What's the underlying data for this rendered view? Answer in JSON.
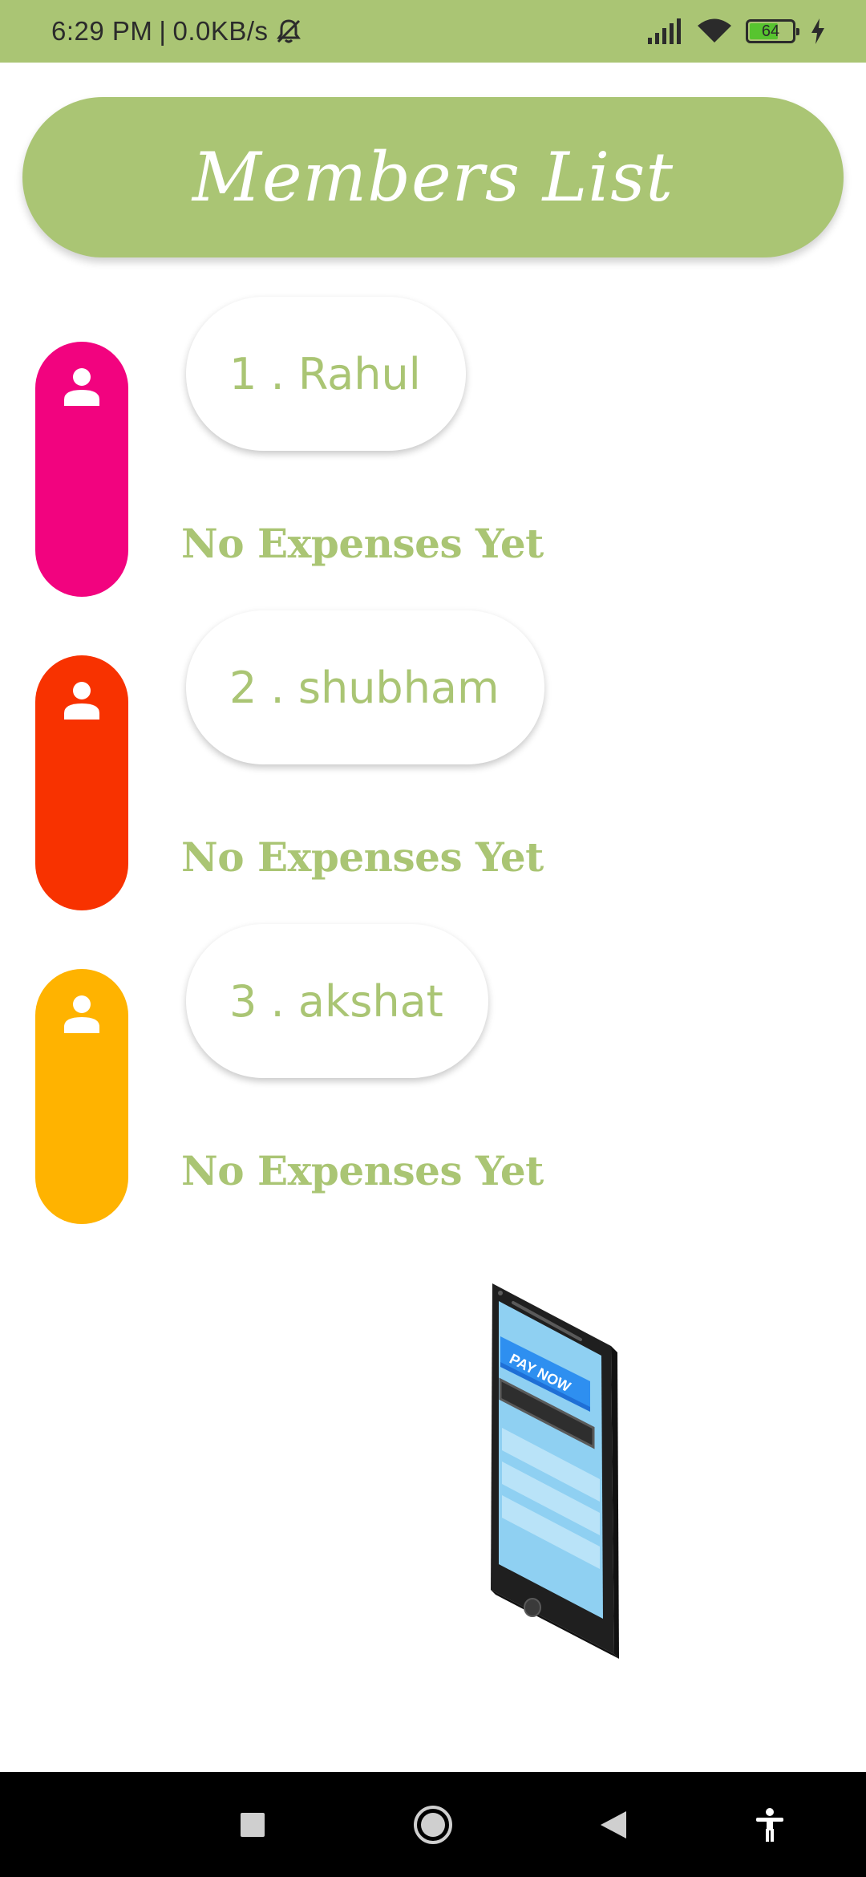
{
  "status_bar": {
    "time": "6:29 PM",
    "separator": "|",
    "network_speed": "0.0KB/s",
    "battery_level": "64",
    "icons": [
      "mute-bell-icon",
      "signal-icon",
      "wifi-icon",
      "battery-icon",
      "charging-icon"
    ]
  },
  "header": {
    "title": "Members List",
    "color": "#aac574"
  },
  "members": [
    {
      "name_label": "1 . Rahul",
      "status": "No Expenses Yet",
      "color": "#f2037f"
    },
    {
      "name_label": "2 . shubham",
      "status": "No Expenses Yet",
      "color": "#f83200"
    },
    {
      "name_label": "3 . akshat",
      "status": "No Expenses Yet",
      "color": "#ffb300"
    }
  ],
  "illustration": {
    "button_text": "PAY NOW",
    "icon": "phone-illustration"
  },
  "nav_bar": {
    "icons": [
      "recents-square-icon",
      "home-circle-icon",
      "back-triangle-icon",
      "accessibility-icon"
    ]
  }
}
